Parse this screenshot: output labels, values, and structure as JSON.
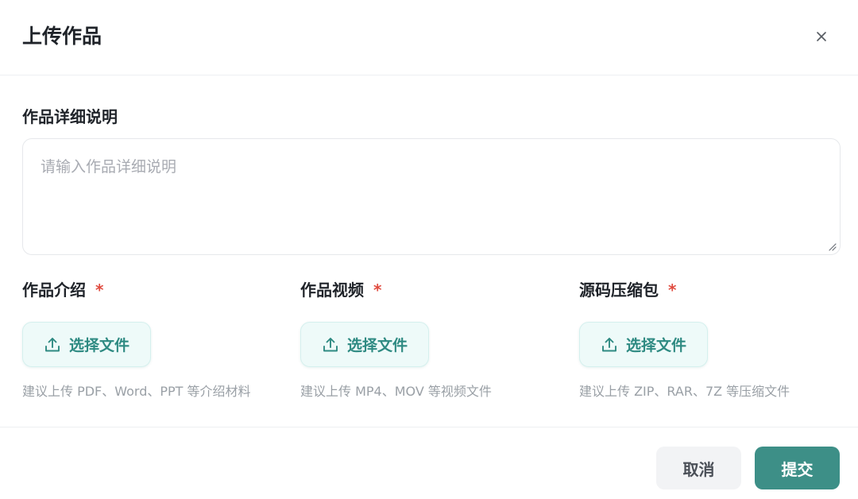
{
  "dialog": {
    "title": "上传作品",
    "close_icon": "close-icon"
  },
  "description": {
    "label": "作品详细说明",
    "placeholder": "请输入作品详细说明",
    "value": ""
  },
  "uploads": [
    {
      "label": "作品介绍",
      "required_mark": "*",
      "button_label": "选择文件",
      "icon": "upload-icon",
      "hint": "建议上传 PDF、Word、PPT 等介绍材料"
    },
    {
      "label": "作品视频",
      "required_mark": "*",
      "button_label": "选择文件",
      "icon": "upload-icon",
      "hint": "建议上传 MP4、MOV 等视频文件"
    },
    {
      "label": "源码压缩包",
      "required_mark": "*",
      "button_label": "选择文件",
      "icon": "upload-icon",
      "hint": "建议上传 ZIP、RAR、7Z 等压缩文件"
    }
  ],
  "footer": {
    "cancel_label": "取消",
    "submit_label": "提交"
  },
  "colors": {
    "accent": "#3d8f87",
    "accent_text": "#2e8a82",
    "upload_bg": "#eefaf9",
    "required": "#e04b3f",
    "hint": "#9aa0a6"
  }
}
